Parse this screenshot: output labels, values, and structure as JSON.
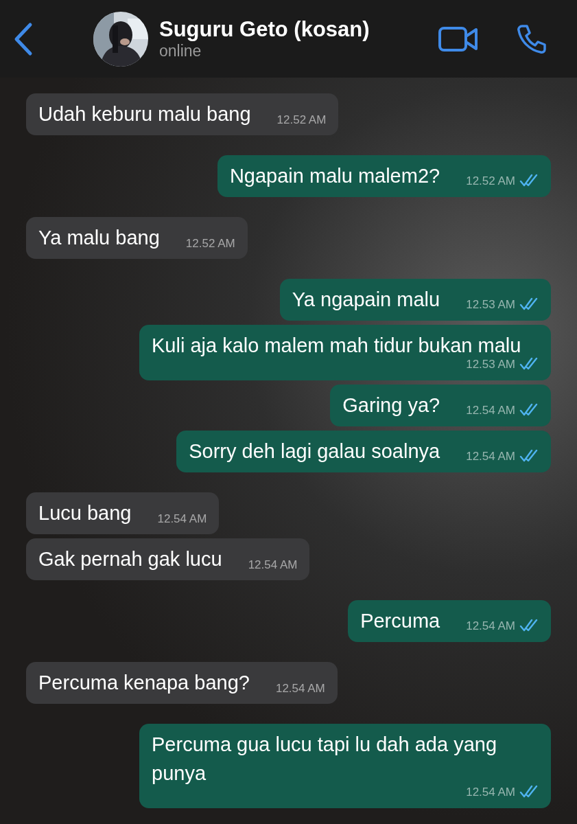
{
  "header": {
    "contact_name": "Suguru Geto (kosan)",
    "status": "online"
  },
  "messages": [
    {
      "outgoing": false,
      "text": "Udah keburu malu bang",
      "time": "12.52 AM"
    },
    {
      "outgoing": true,
      "text": "Ngapain malu malem2?",
      "time": "12.52 AM",
      "read": true
    },
    {
      "outgoing": false,
      "text": "Ya malu bang",
      "time": "12.52 AM"
    },
    {
      "outgoing": true,
      "text": "Ya ngapain malu",
      "time": "12.53 AM",
      "read": true
    },
    {
      "outgoing": true,
      "text": "Kuli aja kalo malem mah tidur bukan malu",
      "time": "12.53 AM",
      "read": true
    },
    {
      "outgoing": true,
      "text": "Garing ya?",
      "time": "12.54 AM",
      "read": true
    },
    {
      "outgoing": true,
      "text": "Sorry deh lagi galau soalnya",
      "time": "12.54 AM",
      "read": true
    },
    {
      "outgoing": false,
      "text": "Lucu bang",
      "time": "12.54 AM"
    },
    {
      "outgoing": false,
      "text": "Gak pernah gak lucu",
      "time": "12.54 AM"
    },
    {
      "outgoing": true,
      "text": "Percuma",
      "time": "12.54 AM",
      "read": true
    },
    {
      "outgoing": false,
      "text": "Percuma kenapa bang?",
      "time": "12.54 AM"
    },
    {
      "outgoing": true,
      "text": "Percuma gua lucu tapi lu dah ada yang punya",
      "time": "12.54 AM",
      "read": true
    }
  ]
}
